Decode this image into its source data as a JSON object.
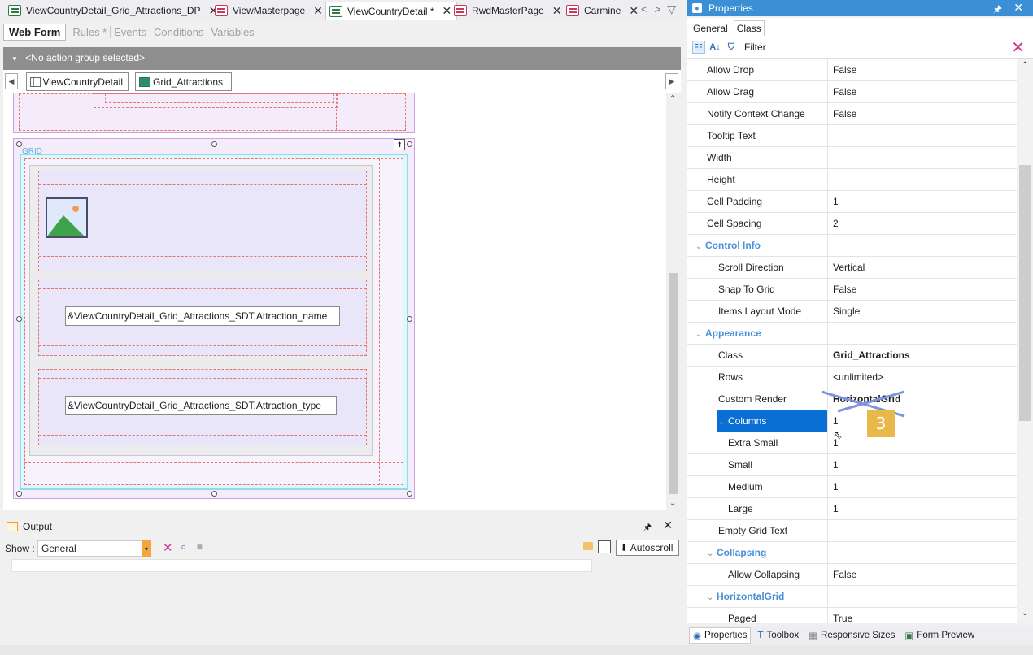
{
  "doc_tabs": [
    {
      "label": "ViewCountryDetail_Grid_Attractions_DP",
      "icon": "dataprovider-icon"
    },
    {
      "label": "ViewMasterpage",
      "icon": "masterpage-icon"
    },
    {
      "label": "ViewCountryDetail *",
      "icon": "webpanel-icon"
    },
    {
      "label": "RwdMasterPage",
      "icon": "masterpage-icon"
    },
    {
      "label": "Carmine",
      "icon": "theme-icon"
    }
  ],
  "sub_tabs": [
    "Web Form",
    "Rules *",
    "Events",
    "Conditions",
    "Variables"
  ],
  "action_group": "<No action group selected>",
  "breadcrumb": [
    "ViewCountryDetail",
    "Grid_Attractions"
  ],
  "canvas": {
    "grid_label": "GRID",
    "attr_name": "&ViewCountryDetail_Grid_Attractions_SDT.Attraction_name",
    "attr_type": "&ViewCountryDetail_Grid_Attractions_SDT.Attraction_type"
  },
  "output": {
    "title": "Output",
    "show_label": "Show :",
    "show_value": "General",
    "autoscroll": "Autoscroll"
  },
  "properties": {
    "title": "Properties",
    "tabs": [
      "General",
      "Class"
    ],
    "filter_label": "Filter",
    "rows": [
      {
        "name": "Allow Drop",
        "value": "False",
        "level": 0
      },
      {
        "name": "Allow Drag",
        "value": "False",
        "level": 0
      },
      {
        "name": "Notify Context Change",
        "value": "False",
        "level": 0
      },
      {
        "name": "Tooltip Text",
        "value": "",
        "level": 0
      },
      {
        "name": "Width",
        "value": "",
        "level": 0
      },
      {
        "name": "Height",
        "value": "",
        "level": 0
      },
      {
        "name": "Cell Padding",
        "value": "1",
        "level": 0
      },
      {
        "name": "Cell Spacing",
        "value": "2",
        "level": 0
      },
      {
        "name": "Control Info",
        "value": "",
        "level": 0,
        "category": true
      },
      {
        "name": "Scroll Direction",
        "value": "Vertical",
        "level": 1
      },
      {
        "name": "Snap To Grid",
        "value": "False",
        "level": 1
      },
      {
        "name": "Items Layout Mode",
        "value": "Single",
        "level": 1
      },
      {
        "name": "Appearance",
        "value": "",
        "level": 0,
        "category": true
      },
      {
        "name": "Class",
        "value": "Grid_Attractions",
        "level": 1,
        "bold": true
      },
      {
        "name": "Rows",
        "value": "<unlimited>",
        "level": 1
      },
      {
        "name": "Custom Render",
        "value": "HorizontalGrid",
        "level": 1,
        "bold": true
      },
      {
        "name": "Columns",
        "value": "1",
        "level": 2,
        "selected": true,
        "expander": true
      },
      {
        "name": "Extra Small",
        "value": "1",
        "level": 2
      },
      {
        "name": "Small",
        "value": "1",
        "level": 2
      },
      {
        "name": "Medium",
        "value": "1",
        "level": 2
      },
      {
        "name": "Large",
        "value": "1",
        "level": 2
      },
      {
        "name": "Empty Grid Text",
        "value": "",
        "level": 1
      },
      {
        "name": "Collapsing",
        "value": "",
        "level": 1,
        "category": true
      },
      {
        "name": "Allow Collapsing",
        "value": "False",
        "level": 2
      },
      {
        "name": "HorizontalGrid",
        "value": "",
        "level": 1,
        "category": true
      },
      {
        "name": "Paged",
        "value": "True",
        "level": 2
      }
    ],
    "annotation_number": "3"
  },
  "bottom_tabs": [
    "Properties",
    "Toolbox",
    "Responsive Sizes",
    "Form Preview"
  ]
}
